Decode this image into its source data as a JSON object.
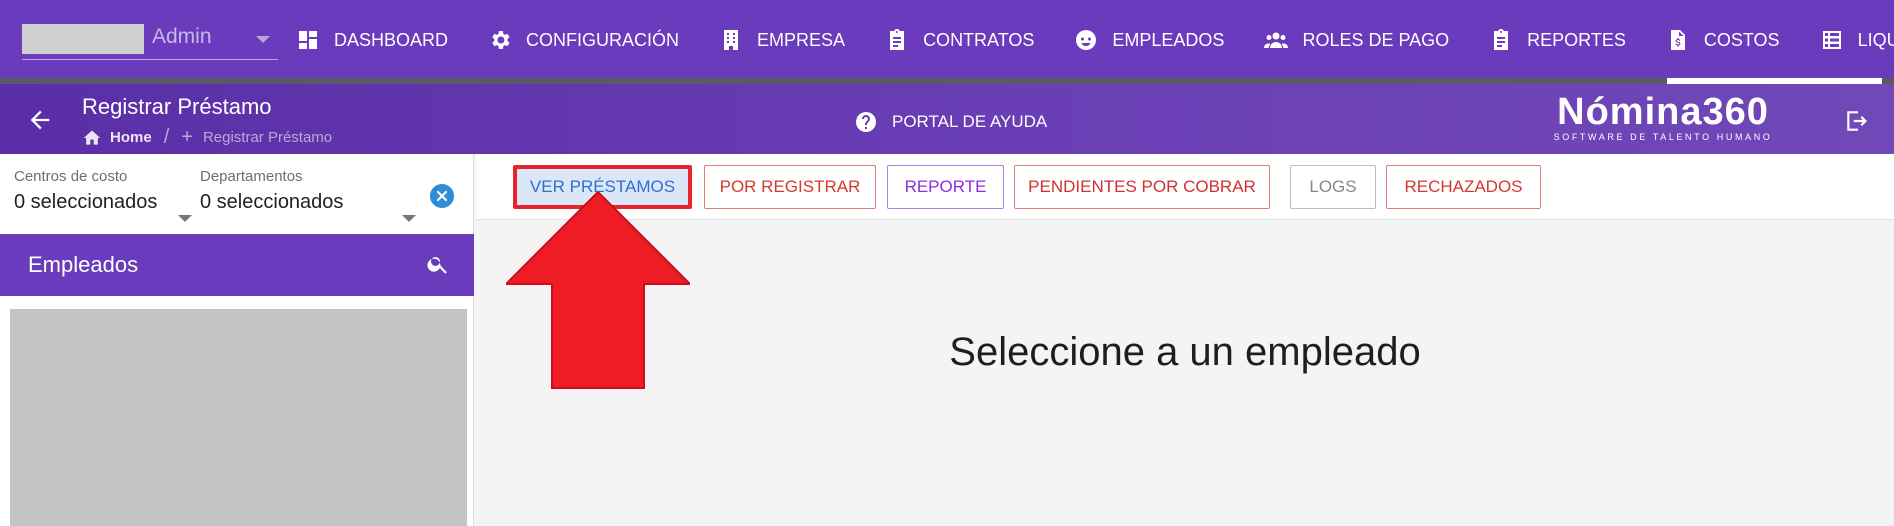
{
  "topnav": {
    "user": {
      "name": "Admin"
    },
    "items": [
      {
        "label": "DASHBOARD",
        "icon": "dashboard-icon"
      },
      {
        "label": "CONFIGURACIÓN",
        "icon": "gear-icon"
      },
      {
        "label": "EMPRESA",
        "icon": "building-icon"
      },
      {
        "label": "CONTRATOS",
        "icon": "clipboard-icon"
      },
      {
        "label": "EMPLEADOS",
        "icon": "face-icon"
      },
      {
        "label": "ROLES DE PAGO",
        "icon": "people-icon"
      },
      {
        "label": "REPORTES",
        "icon": "clipboard-icon"
      },
      {
        "label": "COSTOS",
        "icon": "invoice-icon"
      },
      {
        "label": "LIQUIDACIONE",
        "icon": "list-icon"
      }
    ]
  },
  "subheader": {
    "title": "Registrar Préstamo",
    "breadcrumb": {
      "home": "Home",
      "current": "Registrar Préstamo"
    },
    "help": "PORTAL DE AYUDA",
    "brand": {
      "name": "Nómina360",
      "tagline": "SOFTWARE DE TALENTO HUMANO"
    }
  },
  "filters": {
    "cost_centers": {
      "label": "Centros de costo",
      "value": "0 seleccionados"
    },
    "departments": {
      "label": "Departamentos",
      "value": "0 seleccionados"
    }
  },
  "employees": {
    "title": "Empleados"
  },
  "actions": [
    {
      "label": "VER PRÉSTAMOS",
      "color": "#2f6fcc",
      "active": true
    },
    {
      "label": "POR REGISTRAR",
      "color": "#d33a2c"
    },
    {
      "label": "REPORTE",
      "color": "#8e2de2"
    },
    {
      "label": "PENDIENTES POR COBRAR",
      "color": "#d32f2f"
    },
    {
      "label": "LOGS",
      "color": "#888888"
    },
    {
      "label": "RECHAZADOS",
      "color": "#d33a2c"
    }
  ],
  "main": {
    "empty_message": "Seleccione a un empleado"
  },
  "colors": {
    "primary": "#6a3bbd",
    "annotation": "#e8232b"
  }
}
